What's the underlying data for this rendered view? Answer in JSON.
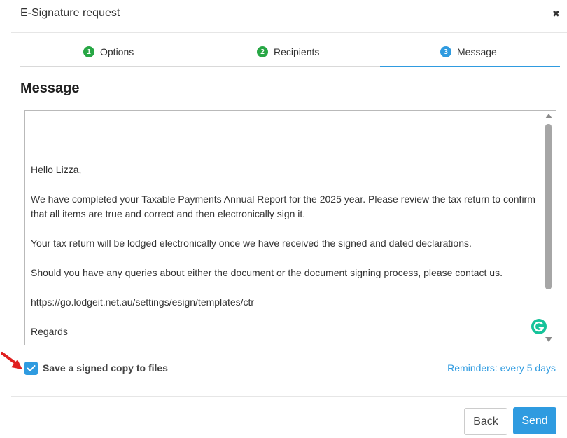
{
  "dialog": {
    "title": "E-Signature request",
    "close_icon": "close-icon"
  },
  "steps": [
    {
      "number": "1",
      "label": "Options",
      "status": "done"
    },
    {
      "number": "2",
      "label": "Recipients",
      "status": "done"
    },
    {
      "number": "3",
      "label": "Message",
      "status": "current"
    }
  ],
  "section_title": "Message",
  "message": {
    "greeting": "Hello Lizza,",
    "paragraph1": "We have completed your Taxable Payments Annual Report for the 2025 year. Please review the tax return to confirm that all items are true and correct and then electronically sign it.",
    "paragraph2": "Your tax return will be lodged electronically once we have received the signed and dated declarations.",
    "paragraph3": "Should you have any queries about either the document or the document signing process, please contact us.",
    "link": "https://go.lodgeit.net.au/settings/esign/templates/ctr",
    "closing": "Regards"
  },
  "options": {
    "save_copy_label": "Save a signed copy to files",
    "save_copy_checked": true,
    "reminders_label": "Reminders: every 5 days"
  },
  "buttons": {
    "back": "Back",
    "send": "Send"
  },
  "colors": {
    "accent": "#2f9be0",
    "step_done": "#28a745",
    "annotation_arrow": "#e02020"
  },
  "icons": [
    "close-icon",
    "check-icon",
    "grammarly-icon",
    "scroll-up-arrow-icon",
    "scroll-down-arrow-icon",
    "red-arrow-icon"
  ]
}
